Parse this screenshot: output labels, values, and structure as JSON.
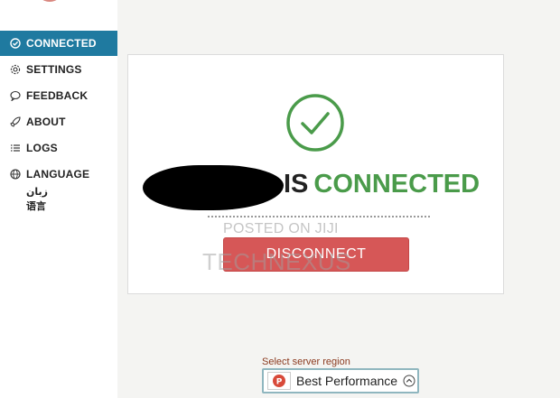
{
  "sidebar": {
    "items": [
      {
        "label": "CONNECTED",
        "icon": "check-circle-icon"
      },
      {
        "label": "SETTINGS",
        "icon": "gear-icon"
      },
      {
        "label": "FEEDBACK",
        "icon": "chat-bubble-icon"
      },
      {
        "label": "ABOUT",
        "icon": "rocket-icon"
      },
      {
        "label": "LOGS",
        "icon": "list-icon"
      },
      {
        "label": "LANGUAGE",
        "icon": "globe-icon"
      }
    ],
    "language_options": [
      "زبان",
      "语言"
    ]
  },
  "main": {
    "status_prefix": "IS",
    "status_word": "CONNECTED",
    "disconnect_label": "DISCONNECT",
    "watermark_posted": "POSTED ON JIJI",
    "watermark_brand": "TECHNEXUS"
  },
  "region": {
    "label": "Select server region",
    "value": "Best Performance"
  },
  "colors": {
    "accent": "#1f7aa0",
    "connected_green": "#4a9b4a",
    "disconnect_red": "#d65757"
  }
}
